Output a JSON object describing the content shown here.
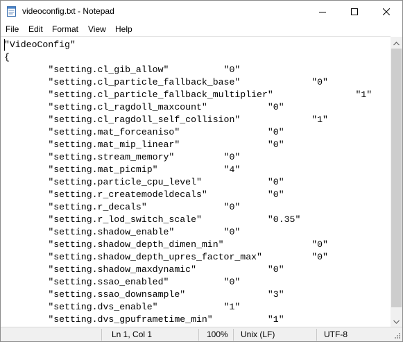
{
  "window": {
    "title": "videoconfig.txt - Notepad",
    "icon": "notepad-icon",
    "controls": [
      "minimize-icon",
      "maximize-icon",
      "close-icon"
    ]
  },
  "menu": {
    "items": [
      {
        "label": "File"
      },
      {
        "label": "Edit"
      },
      {
        "label": "Format"
      },
      {
        "label": "View"
      },
      {
        "label": "Help"
      }
    ]
  },
  "editor": {
    "lines": [
      {
        "text": "\"VideoConfig\""
      },
      {
        "text": "{"
      },
      {
        "text": "\t\"setting.cl_gib_allow\"\t\t\"0\""
      },
      {
        "text": "\t\"setting.cl_particle_fallback_base\"\t\t\"0\""
      },
      {
        "text": "\t\"setting.cl_particle_fallback_multiplier\"\t\t\"1\""
      },
      {
        "text": "\t\"setting.cl_ragdoll_maxcount\"\t\t\"0\""
      },
      {
        "text": "\t\"setting.cl_ragdoll_self_collision\"\t\t\"1\""
      },
      {
        "text": "\t\"setting.mat_forceaniso\"\t\t\"0\""
      },
      {
        "text": "\t\"setting.mat_mip_linear\"\t\t\"0\""
      },
      {
        "text": "\t\"setting.stream_memory\"\t\t\"0\""
      },
      {
        "text": "\t\"setting.mat_picmip\"\t\t\"4\""
      },
      {
        "text": "\t\"setting.particle_cpu_level\"\t\t\"0\""
      },
      {
        "text": "\t\"setting.r_createmodeldecals\"\t\t\"0\""
      },
      {
        "text": "\t\"setting.r_decals\"\t\t\"0\""
      },
      {
        "text": "\t\"setting.r_lod_switch_scale\"\t\t\"0.35\""
      },
      {
        "text": "\t\"setting.shadow_enable\"\t\t\"0\""
      },
      {
        "text": "\t\"setting.shadow_depth_dimen_min\"\t\t\"0\""
      },
      {
        "text": "\t\"setting.shadow_depth_upres_factor_max\"\t\t\"0\""
      },
      {
        "text": "\t\"setting.shadow_maxdynamic\"\t\t\"0\""
      },
      {
        "text": "\t\"setting.ssao_enabled\"\t\t\"0\""
      },
      {
        "text": "\t\"setting.ssao_downsample\"\t\t\"3\""
      },
      {
        "text": "\t\"setting.dvs_enable\"\t\t\"1\""
      },
      {
        "text": "\t\"setting.dvs_gpuframetime_min\"\t\t\"1\""
      }
    ]
  },
  "status": {
    "position": "Ln 1, Col 1",
    "zoom": "100%",
    "line_ending": "Unix (LF)",
    "encoding": "UTF-8"
  }
}
